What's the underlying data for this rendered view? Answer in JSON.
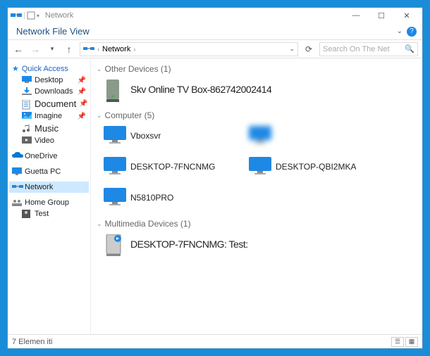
{
  "titlebar": {
    "title": "Network"
  },
  "menubar": {
    "label": "Network  File  View"
  },
  "address": {
    "path": "Network",
    "search_placeholder": "Search On The Net"
  },
  "sidebar": {
    "quick_access": "Quick Access",
    "items_quick": [
      {
        "label": "Desktop"
      },
      {
        "label": "Downloads"
      },
      {
        "label": "Document"
      },
      {
        "label": "Imagine"
      },
      {
        "label": "Music"
      },
      {
        "label": "Video"
      }
    ],
    "onedrive": "OneDrive",
    "thispc": "Guetta PC",
    "network": "Network",
    "homegroup": "Home Group",
    "test": "Test"
  },
  "groups": {
    "other": {
      "header": "Other Devices (1)",
      "items": [
        {
          "label": "Skv Online TV Box-862742002414"
        }
      ]
    },
    "computer": {
      "header": "Computer (5)",
      "items": [
        {
          "label": "Vboxsvr"
        },
        {
          "label": ""
        },
        {
          "label": "DESKTOP-7FNCNMG"
        },
        {
          "label": "DESKTOP-QBI2MKA"
        },
        {
          "label": "N5810PRO"
        }
      ]
    },
    "multimedia": {
      "header": "Multimedia Devices (1)",
      "items": [
        {
          "label": "DESKTOP-7FNCNMG: Test:"
        }
      ]
    }
  },
  "status": {
    "count": "7 Elemen iti"
  }
}
